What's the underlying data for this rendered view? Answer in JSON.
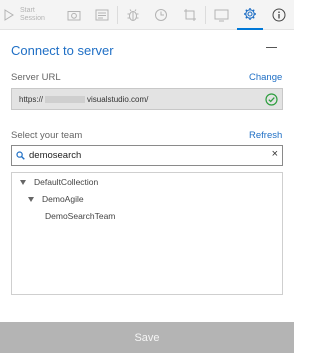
{
  "toolbar": {
    "start_line1": "Start",
    "start_line2": "Session"
  },
  "panel": {
    "title": "Connect to server"
  },
  "server": {
    "label": "Server URL",
    "change_label": "Change",
    "url_prefix": "https://",
    "url_suffix": "visualstudio.com/"
  },
  "team": {
    "label": "Select your team",
    "refresh_label": "Refresh",
    "search_value": "demosearch",
    "clear_label": "×"
  },
  "tree": {
    "nodes": [
      "DefaultCollection",
      "DemoAgile",
      "DemoSearchTeam"
    ]
  },
  "footer": {
    "save_label": "Save"
  },
  "colors": {
    "accent": "#1f6fc5",
    "active_tab": "#0078d7",
    "success": "#2e9e3f"
  }
}
